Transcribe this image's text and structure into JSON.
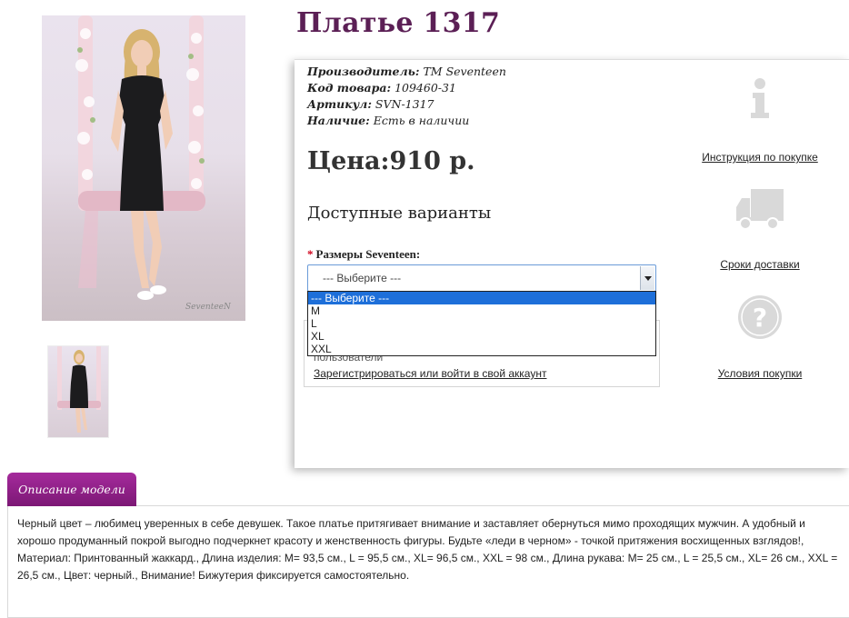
{
  "product": {
    "title": "Платье 1317",
    "manufacturer_label": "Производитель:",
    "manufacturer_value": "TM Seventeen",
    "code_label": "Код товара:",
    "code_value": "109460-31",
    "sku_label": "Артикул:",
    "sku_value": "SVN-1317",
    "stock_label": "Наличие:",
    "stock_value": "Есть в наличии",
    "price": "Цена:910 р.",
    "variants_heading": "Доступные варианты",
    "photo_watermark": "SeventeeN"
  },
  "size_select": {
    "required_mark": "*",
    "label": "Размеры Seventeen:",
    "selected": "--- Выберите ---",
    "options": [
      "--- Выберите ---",
      "M",
      "L",
      "XL",
      "XXL"
    ]
  },
  "account_box": {
    "partial_text": "пользователи",
    "register_link": "Зарегистрироваться или войти в свой аккаунт"
  },
  "side_links": {
    "instruction": "Инструкция по покупке",
    "delivery": "Сроки доставки",
    "terms": "Условия покупки"
  },
  "description": {
    "tab_label": "Описание модели",
    "text": "Черный цвет – любимец уверенных в себе девушек. Такое платье притягивает внимание и заставляет обернуться мимо проходящих мужчин. А удобный и хорошо продуманный покрой выгодно подчеркнет красоту и женственность фигуры. Будьте «леди в черном» - точкой притяжения восхищенных взглядов!, Материал: Принтованный жаккард., Длина изделия: M= 93,5 см., L = 95,5 см., XL= 96,5 см., XXL = 98 см., Длина рукава: M= 25 см., L = 25,5 см., XL= 26 см., XXL = 26,5 см., Цвет: черный., Внимание! Бижутерия фиксируется самостоятельно."
  },
  "colors": {
    "title": "#5b1f55",
    "tab": "#a52a9c",
    "select_highlight": "#1e6fd9",
    "icon_gray": "#d9d9d9"
  }
}
